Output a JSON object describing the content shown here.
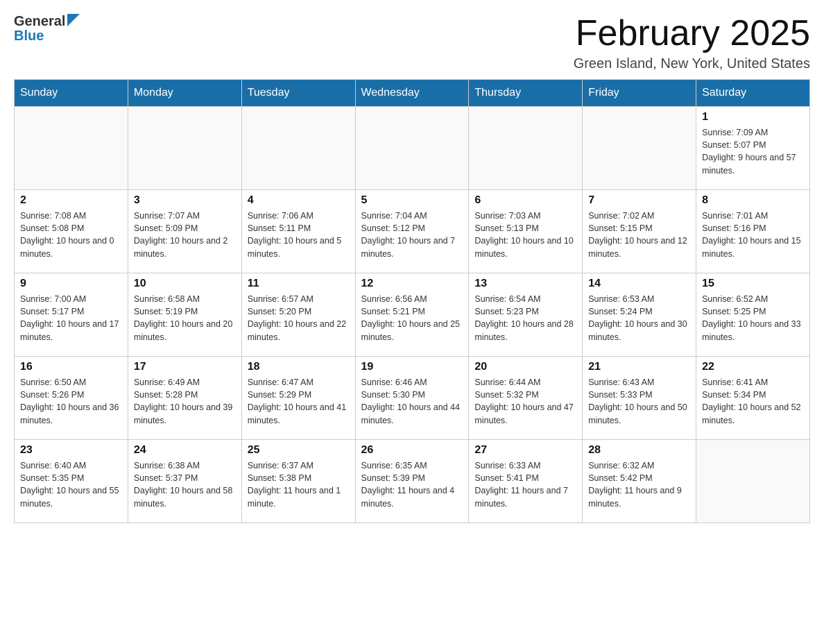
{
  "header": {
    "logo_general": "General",
    "logo_blue": "Blue",
    "month_title": "February 2025",
    "location": "Green Island, New York, United States"
  },
  "days_of_week": [
    "Sunday",
    "Monday",
    "Tuesday",
    "Wednesday",
    "Thursday",
    "Friday",
    "Saturday"
  ],
  "weeks": [
    [
      {
        "day": "",
        "info": ""
      },
      {
        "day": "",
        "info": ""
      },
      {
        "day": "",
        "info": ""
      },
      {
        "day": "",
        "info": ""
      },
      {
        "day": "",
        "info": ""
      },
      {
        "day": "",
        "info": ""
      },
      {
        "day": "1",
        "info": "Sunrise: 7:09 AM\nSunset: 5:07 PM\nDaylight: 9 hours and 57 minutes."
      }
    ],
    [
      {
        "day": "2",
        "info": "Sunrise: 7:08 AM\nSunset: 5:08 PM\nDaylight: 10 hours and 0 minutes."
      },
      {
        "day": "3",
        "info": "Sunrise: 7:07 AM\nSunset: 5:09 PM\nDaylight: 10 hours and 2 minutes."
      },
      {
        "day": "4",
        "info": "Sunrise: 7:06 AM\nSunset: 5:11 PM\nDaylight: 10 hours and 5 minutes."
      },
      {
        "day": "5",
        "info": "Sunrise: 7:04 AM\nSunset: 5:12 PM\nDaylight: 10 hours and 7 minutes."
      },
      {
        "day": "6",
        "info": "Sunrise: 7:03 AM\nSunset: 5:13 PM\nDaylight: 10 hours and 10 minutes."
      },
      {
        "day": "7",
        "info": "Sunrise: 7:02 AM\nSunset: 5:15 PM\nDaylight: 10 hours and 12 minutes."
      },
      {
        "day": "8",
        "info": "Sunrise: 7:01 AM\nSunset: 5:16 PM\nDaylight: 10 hours and 15 minutes."
      }
    ],
    [
      {
        "day": "9",
        "info": "Sunrise: 7:00 AM\nSunset: 5:17 PM\nDaylight: 10 hours and 17 minutes."
      },
      {
        "day": "10",
        "info": "Sunrise: 6:58 AM\nSunset: 5:19 PM\nDaylight: 10 hours and 20 minutes."
      },
      {
        "day": "11",
        "info": "Sunrise: 6:57 AM\nSunset: 5:20 PM\nDaylight: 10 hours and 22 minutes."
      },
      {
        "day": "12",
        "info": "Sunrise: 6:56 AM\nSunset: 5:21 PM\nDaylight: 10 hours and 25 minutes."
      },
      {
        "day": "13",
        "info": "Sunrise: 6:54 AM\nSunset: 5:23 PM\nDaylight: 10 hours and 28 minutes."
      },
      {
        "day": "14",
        "info": "Sunrise: 6:53 AM\nSunset: 5:24 PM\nDaylight: 10 hours and 30 minutes."
      },
      {
        "day": "15",
        "info": "Sunrise: 6:52 AM\nSunset: 5:25 PM\nDaylight: 10 hours and 33 minutes."
      }
    ],
    [
      {
        "day": "16",
        "info": "Sunrise: 6:50 AM\nSunset: 5:26 PM\nDaylight: 10 hours and 36 minutes."
      },
      {
        "day": "17",
        "info": "Sunrise: 6:49 AM\nSunset: 5:28 PM\nDaylight: 10 hours and 39 minutes."
      },
      {
        "day": "18",
        "info": "Sunrise: 6:47 AM\nSunset: 5:29 PM\nDaylight: 10 hours and 41 minutes."
      },
      {
        "day": "19",
        "info": "Sunrise: 6:46 AM\nSunset: 5:30 PM\nDaylight: 10 hours and 44 minutes."
      },
      {
        "day": "20",
        "info": "Sunrise: 6:44 AM\nSunset: 5:32 PM\nDaylight: 10 hours and 47 minutes."
      },
      {
        "day": "21",
        "info": "Sunrise: 6:43 AM\nSunset: 5:33 PM\nDaylight: 10 hours and 50 minutes."
      },
      {
        "day": "22",
        "info": "Sunrise: 6:41 AM\nSunset: 5:34 PM\nDaylight: 10 hours and 52 minutes."
      }
    ],
    [
      {
        "day": "23",
        "info": "Sunrise: 6:40 AM\nSunset: 5:35 PM\nDaylight: 10 hours and 55 minutes."
      },
      {
        "day": "24",
        "info": "Sunrise: 6:38 AM\nSunset: 5:37 PM\nDaylight: 10 hours and 58 minutes."
      },
      {
        "day": "25",
        "info": "Sunrise: 6:37 AM\nSunset: 5:38 PM\nDaylight: 11 hours and 1 minute."
      },
      {
        "day": "26",
        "info": "Sunrise: 6:35 AM\nSunset: 5:39 PM\nDaylight: 11 hours and 4 minutes."
      },
      {
        "day": "27",
        "info": "Sunrise: 6:33 AM\nSunset: 5:41 PM\nDaylight: 11 hours and 7 minutes."
      },
      {
        "day": "28",
        "info": "Sunrise: 6:32 AM\nSunset: 5:42 PM\nDaylight: 11 hours and 9 minutes."
      },
      {
        "day": "",
        "info": ""
      }
    ]
  ]
}
